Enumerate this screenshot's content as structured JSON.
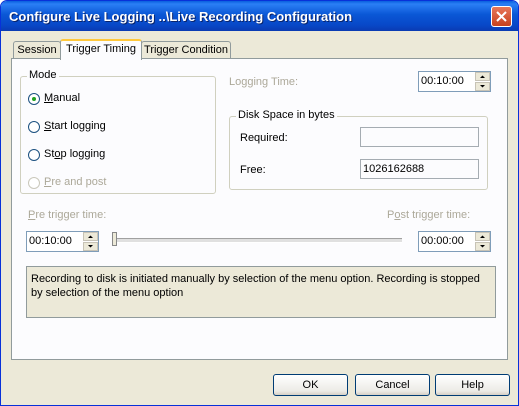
{
  "window": {
    "title": "Configure Live Logging ..\\Live Recording Configuration"
  },
  "tabs": [
    {
      "label": "Session",
      "active": false
    },
    {
      "label": "Trigger Timing",
      "active": true
    },
    {
      "label": "Trigger Condition",
      "active": false
    }
  ],
  "mode": {
    "title": "Mode",
    "options": [
      {
        "label": "Manual",
        "mnemonic": "M",
        "rest": "anual",
        "checked": true,
        "enabled": true
      },
      {
        "label": "Start logging",
        "mnemonic": "S",
        "rest": "tart logging",
        "checked": false,
        "enabled": true
      },
      {
        "label": "Stop logging",
        "mnemonic": "o",
        "pre": "St",
        "rest": "p logging",
        "checked": false,
        "enabled": true
      },
      {
        "label": "Pre and post",
        "mnemonic": "P",
        "rest": "re and post",
        "checked": false,
        "enabled": false
      }
    ]
  },
  "logging_time": {
    "label": "Logging Time:",
    "value": "00:10:00"
  },
  "disk_space": {
    "title": "Disk Space in bytes",
    "required_label": "Required:",
    "required_value": "",
    "free_label": "Free:",
    "free_value": "1026162688"
  },
  "pre_trigger": {
    "label": "Pre trigger time:",
    "mnemonic": "P",
    "rest": "re trigger time:",
    "value": "00:10:00"
  },
  "post_trigger": {
    "label": "Post trigger time:",
    "mnemonic": "o",
    "pre": "P",
    "rest": "st trigger time:",
    "value": "00:00:00"
  },
  "description": "Recording to disk is initiated manually by selection of the menu option. Recording is stopped by selection of the menu option",
  "buttons": {
    "ok": "OK",
    "cancel": "Cancel",
    "help": "Help"
  }
}
